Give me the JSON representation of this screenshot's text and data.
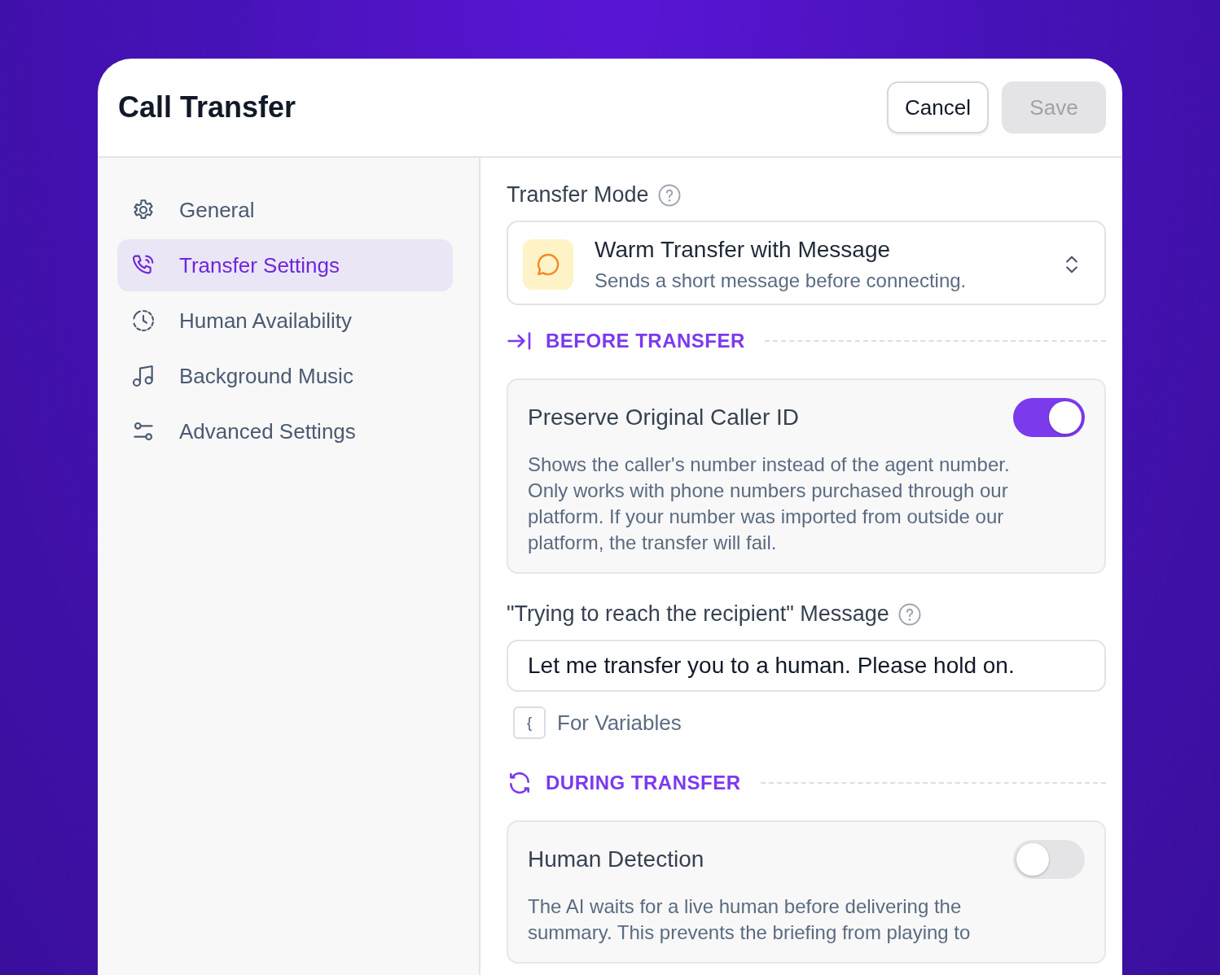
{
  "window": {
    "title": "Call Transfer"
  },
  "header_buttons": [
    {
      "label": "Cancel",
      "kind": "secondary",
      "disabled": false
    },
    {
      "label": "Save",
      "kind": "primary",
      "disabled": true
    }
  ],
  "sidebar": {
    "items": [
      {
        "label": "General",
        "selected": false
      },
      {
        "label": "Transfer Settings",
        "selected": true
      },
      {
        "label": "Human Availability",
        "selected": false
      },
      {
        "label": "Background Music",
        "selected": false
      },
      {
        "label": "Advanced Settings",
        "selected": false
      }
    ]
  },
  "transfer_mode": {
    "label": "Transfer Mode",
    "value": "Warm Transfer with Message",
    "description": "Sends a short message before connecting."
  },
  "groups": [
    {
      "title": "BEFORE TRANSFER",
      "items": [
        {
          "kind": "toggle",
          "title": "Preserve Original Caller ID",
          "on": true,
          "description": "Shows the caller's number instead of the agent number. Only works with phone numbers purchased through our platform. If your number was imported from outside our platform, the transfer will fail."
        },
        {
          "kind": "message",
          "label": "\"Trying to reach the recipient\" Message",
          "value": "Let me transfer you to a human. Please hold on.",
          "key": "{",
          "hint": "For Variables"
        }
      ]
    },
    {
      "title": "DURING TRANSFER",
      "items": [
        {
          "kind": "toggle",
          "title": "Human Detection",
          "on": false,
          "description": "The AI waits for a live human before delivering the summary. This prevents the briefing from playing to"
        }
      ]
    }
  ]
}
